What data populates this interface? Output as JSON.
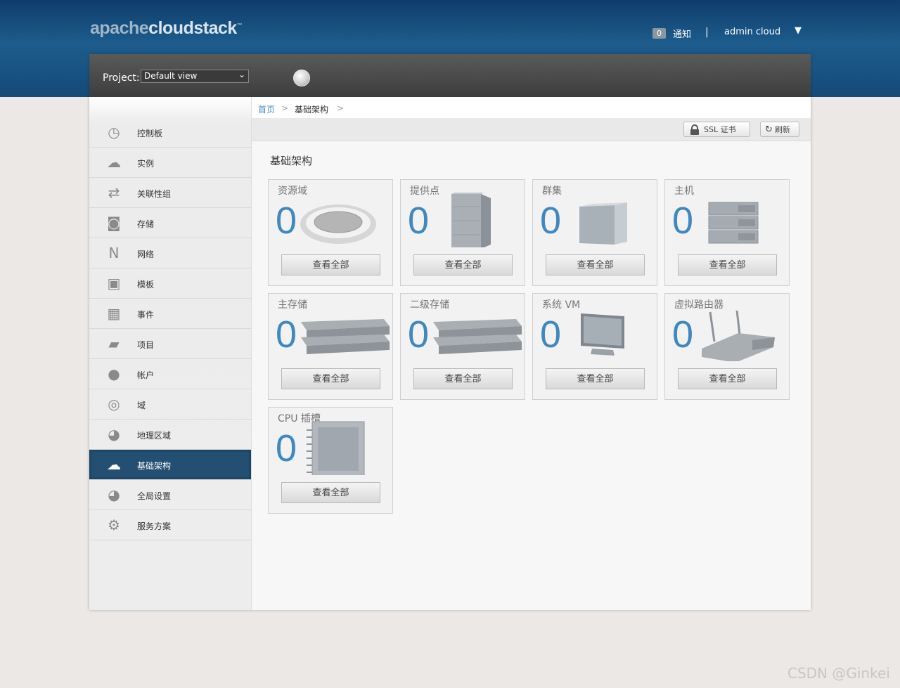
{
  "header": {
    "logo_a": "apache",
    "logo_b": "cloudstack",
    "logo_tm": "™",
    "notifications": {
      "count": "0",
      "label": "通知"
    },
    "separator": "|",
    "user": "admin cloud"
  },
  "projectbar": {
    "label": "Project:",
    "selected": "Default view"
  },
  "sidebar": {
    "items": [
      {
        "label": "控制板",
        "icon": "dashboard-icon"
      },
      {
        "label": "实例",
        "icon": "cloud-icon"
      },
      {
        "label": "关联性组",
        "icon": "affinity-icon"
      },
      {
        "label": "存储",
        "icon": "storage-icon"
      },
      {
        "label": "网络",
        "icon": "network-icon"
      },
      {
        "label": "模板",
        "icon": "template-icon"
      },
      {
        "label": "事件",
        "icon": "calendar-icon"
      },
      {
        "label": "项目",
        "icon": "folder-icon"
      },
      {
        "label": "帐户",
        "icon": "user-icon"
      },
      {
        "label": "域",
        "icon": "domain-icon"
      },
      {
        "label": "地理区域",
        "icon": "globe-icon"
      },
      {
        "label": "基础架构",
        "icon": "infrastructure-icon",
        "active": true
      },
      {
        "label": "全局设置",
        "icon": "settings-globe-icon"
      },
      {
        "label": "服务方案",
        "icon": "gear-icon"
      }
    ]
  },
  "breadcrumb": {
    "home": "首页",
    "sep": ">",
    "current": "基础架构"
  },
  "toolbar": {
    "ssl_label": "SSL 证书",
    "refresh_label": "刷新"
  },
  "page_title": "基础架构",
  "cards": [
    {
      "title": "资源域",
      "count": "0",
      "button": "查看全部",
      "icon": "zone-icon"
    },
    {
      "title": "提供点",
      "count": "0",
      "button": "查看全部",
      "icon": "pod-icon"
    },
    {
      "title": "群集",
      "count": "0",
      "button": "查看全部",
      "icon": "cluster-icon"
    },
    {
      "title": "主机",
      "count": "0",
      "button": "查看全部",
      "icon": "host-icon"
    },
    {
      "title": "主存储",
      "count": "0",
      "button": "查看全部",
      "icon": "primary-storage-icon"
    },
    {
      "title": "二级存储",
      "count": "0",
      "button": "查看全部",
      "icon": "secondary-storage-icon"
    },
    {
      "title": "系统 VM",
      "count": "0",
      "button": "查看全部",
      "icon": "monitor-icon"
    },
    {
      "title": "虚拟路由器",
      "count": "0",
      "button": "查看全部",
      "icon": "router-icon"
    },
    {
      "title": "CPU 插槽",
      "count": "0",
      "button": "查看全部",
      "icon": "cpu-icon"
    }
  ],
  "watermark": "CSDN @Ginkei"
}
